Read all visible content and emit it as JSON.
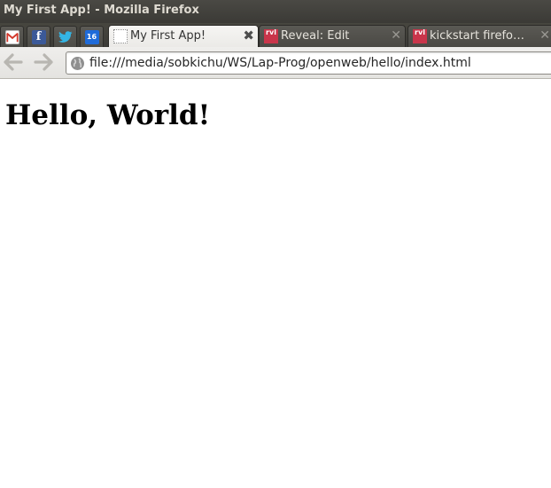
{
  "window": {
    "title": "My First App! - Mozilla Firefox"
  },
  "app_tabs": [
    {
      "name": "gmail",
      "icon": "gmail-icon"
    },
    {
      "name": "facebook",
      "icon": "facebook-icon",
      "glyph": "f"
    },
    {
      "name": "twitter",
      "icon": "twitter-icon"
    },
    {
      "name": "calendar",
      "icon": "calendar-icon",
      "glyph": "16"
    }
  ],
  "tabs": [
    {
      "label": "My First App!",
      "active": true,
      "icon": "blank-page-icon",
      "close": "✖"
    },
    {
      "label": "Reveal: Edit",
      "active": false,
      "icon": "rvl-icon",
      "favtext": "rvl",
      "close": "✕"
    },
    {
      "label": "kickstart firefo…",
      "active": false,
      "icon": "rvl-icon",
      "favtext": "rvl",
      "close": "✕"
    }
  ],
  "navigation": {
    "back_icon": "back-arrow-icon",
    "forward_icon": "forward-arrow-icon",
    "url": "file:///media/sobkichu/WS/Lap-Prog/openweb/hello/index.html"
  },
  "page": {
    "heading": "Hello, World!"
  },
  "colors": {
    "titlebar": "#3b3a36",
    "active_tab": "#f2f1ef",
    "rvl_favicon": "#c9354a",
    "facebook": "#3b5998",
    "twitter": "#33b5e5",
    "calendar": "#1f6bd9"
  }
}
